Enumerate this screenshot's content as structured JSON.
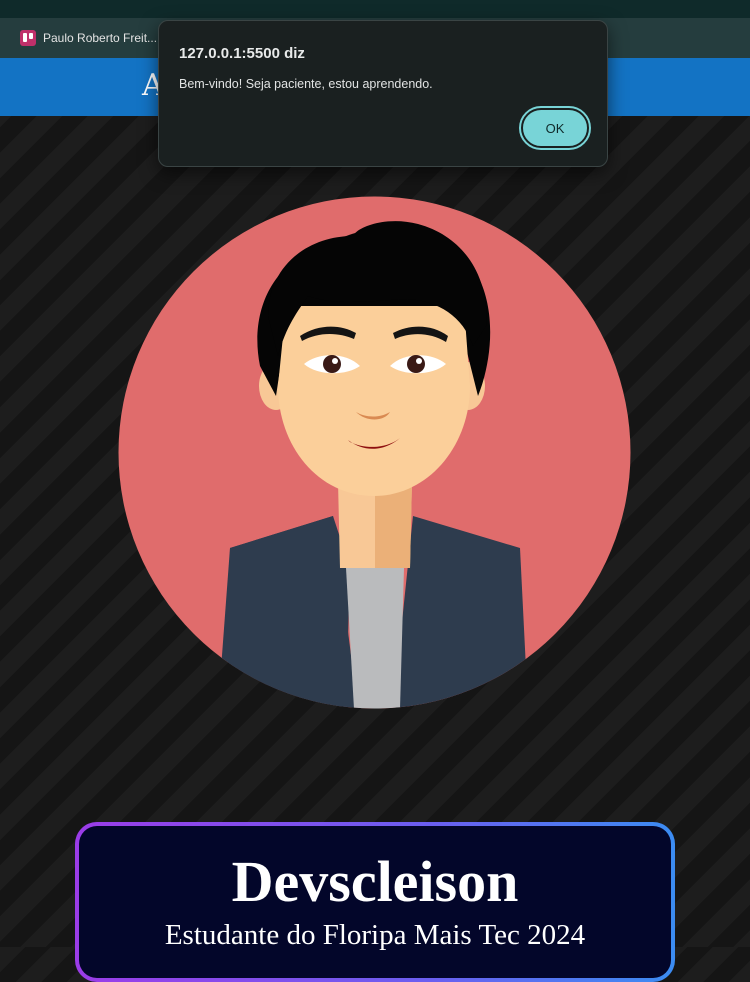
{
  "browser": {
    "bookmark": {
      "label": "Paulo Roberto Freit...",
      "icon": "trello-icon"
    }
  },
  "site": {
    "header_title": "A"
  },
  "hero": {
    "avatar_icon": "developer-avatar-illustration"
  },
  "profile_card": {
    "name": "Devscleison",
    "subtitle": "Estudante do Floripa Mais Tec 2024"
  },
  "alert_dialog": {
    "origin": "127.0.0.1:5500 diz",
    "message": "Bem-vindo! Seja paciente, estou aprendendo.",
    "ok_label": "OK"
  },
  "colors": {
    "site_header": "#1373c4",
    "avatar_circle": "#e06c6c",
    "card_border_start": "#9b3ce8",
    "card_border_end": "#3b8cf2",
    "card_background": "#03062a",
    "ok_button": "#78d4d7"
  }
}
